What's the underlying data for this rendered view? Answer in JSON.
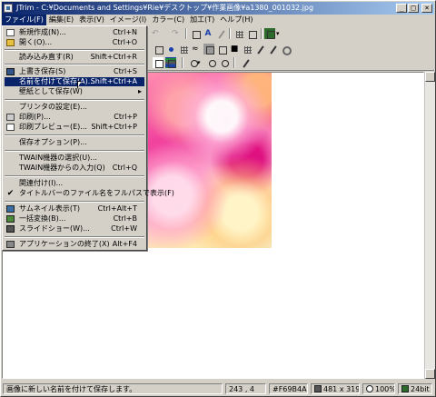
{
  "window": {
    "title": "JTrim - C:¥Documents and Settings¥Rie¥デスクトップ¥作業画像¥a1380_001032.jpg",
    "buttons": {
      "minimize": "_",
      "maximize": "□",
      "close": "×"
    }
  },
  "menubar": {
    "items": [
      "ファイル(F)",
      "編集(E)",
      "表示(V)",
      "イメージ(I)",
      "カラー(C)",
      "加工(T)",
      "ヘルプ(H)"
    ]
  },
  "file_menu": {
    "items": [
      {
        "label": "新規作成(N)...",
        "shortcut": "Ctrl+N",
        "icon": "new-file-icon"
      },
      {
        "label": "開く(O)...",
        "shortcut": "Ctrl+O",
        "icon": "open-folder-icon"
      },
      {
        "label": "読み込み直す(R)",
        "shortcut": "Shift+Ctrl+R"
      },
      {
        "label": "上書き保存(S)",
        "shortcut": "Ctrl+S",
        "icon": "save-icon"
      },
      {
        "label": "名前を付けて保存(A)...",
        "shortcut": "Shift+Ctrl+A"
      },
      {
        "label": "壁紙として保存(W)",
        "arrow": "▸"
      },
      {
        "label": "プリンタの設定(E)..."
      },
      {
        "label": "印刷(P)...",
        "shortcut": "Ctrl+P",
        "icon": "print-icon"
      },
      {
        "label": "印刷プレビュー(E)...",
        "shortcut": "Shift+Ctrl+P",
        "icon": "print-preview-icon"
      },
      {
        "label": "保存オプション(P)..."
      },
      {
        "label": "TWAIN機器の選択(U)..."
      },
      {
        "label": "TWAIN機器からの入力(Q)",
        "shortcut": "Ctrl+Q"
      },
      {
        "label": "関連付け(I)..."
      },
      {
        "label": "タイトルバーのファイル名をフルパスで表示(F)",
        "check": "✔"
      },
      {
        "label": "サムネイル表示(T)",
        "shortcut": "Ctrl+Alt+T",
        "icon": "thumbnail-icon"
      },
      {
        "label": "一括変換(B)...",
        "shortcut": "Ctrl+B",
        "icon": "batch-icon"
      },
      {
        "label": "スライドショー(W)...",
        "shortcut": "Ctrl+W",
        "icon": "slideshow-icon"
      },
      {
        "label": "アプリケーションの終了(X)",
        "shortcut": "Alt+F4",
        "icon": "exit-icon"
      }
    ]
  },
  "statusbar": {
    "message": "画像に新しい名前を付けて保存します。",
    "coords": "243 , 4",
    "color": "#F69B4A",
    "size": "481 x 319",
    "zoom": "100%",
    "depth": "24bit"
  }
}
